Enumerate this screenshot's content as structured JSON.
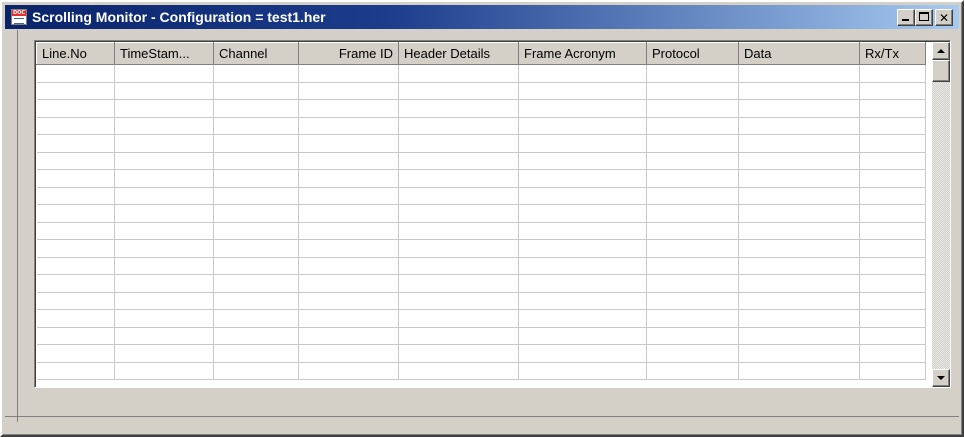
{
  "window": {
    "title": "Scrolling Monitor - Configuration = test1.her",
    "icon_text": "DOC",
    "icon": "document-icon"
  },
  "title_buttons": {
    "minimize": "minimize-icon",
    "maximize": "maximize-icon",
    "close_label": "✕"
  },
  "grid": {
    "columns": [
      {
        "label": "Line.No"
      },
      {
        "label": "TimeStam..."
      },
      {
        "label": "Channel"
      },
      {
        "label": "Frame ID"
      },
      {
        "label": "Header Details"
      },
      {
        "label": "Frame Acronym"
      },
      {
        "label": "Protocol"
      },
      {
        "label": "Data"
      },
      {
        "label": "Rx/Tx"
      }
    ],
    "row_count": 18
  },
  "colors": {
    "title_gradient_start": "#0a246a",
    "title_gradient_end": "#a6caf0",
    "face": "#d4d0c8"
  }
}
